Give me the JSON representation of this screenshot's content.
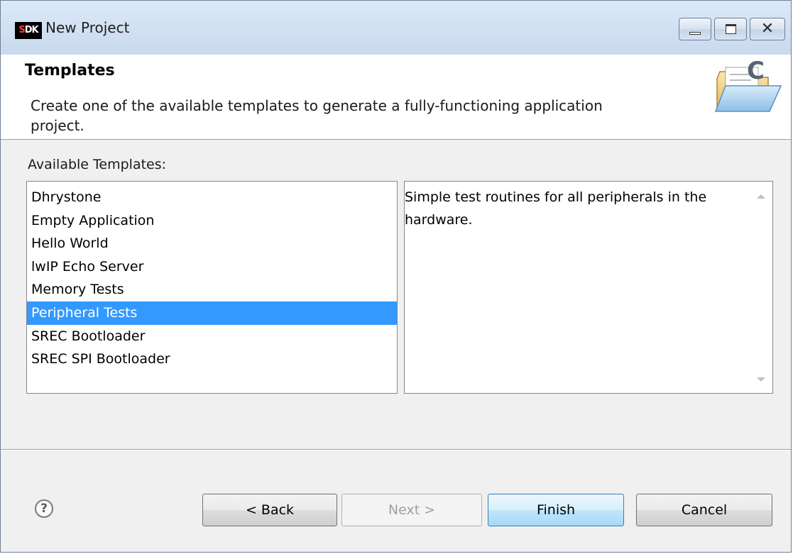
{
  "window": {
    "title": "New Project",
    "app_icon_text_s": "S",
    "app_icon_text_rest": "DK",
    "controls": {
      "minimize": "minimize",
      "maximize": "maximize",
      "close": "✕"
    }
  },
  "header": {
    "title": "Templates",
    "description": "Create one of the available templates to generate a fully-functioning application project.",
    "icon": "new-c-project-folder-icon"
  },
  "templates": {
    "label": "Available Templates:",
    "items": [
      {
        "label": "Dhrystone",
        "selected": false
      },
      {
        "label": "Empty Application",
        "selected": false
      },
      {
        "label": "Hello World",
        "selected": false
      },
      {
        "label": "lwIP Echo Server",
        "selected": false
      },
      {
        "label": "Memory Tests",
        "selected": false
      },
      {
        "label": "Peripheral Tests",
        "selected": true
      },
      {
        "label": "SREC Bootloader",
        "selected": false
      },
      {
        "label": "SREC SPI Bootloader",
        "selected": false
      }
    ],
    "description": "Simple test routines for all peripherals in the hardware."
  },
  "footer": {
    "help": "?",
    "back_label": "< Back",
    "next_label": "Next >",
    "finish_label": "Finish",
    "cancel_label": "Cancel",
    "next_enabled": false
  },
  "colors": {
    "selection": "#3399ff",
    "titlebar": "#c9daee",
    "default_button_border": "#3c7fb1"
  }
}
